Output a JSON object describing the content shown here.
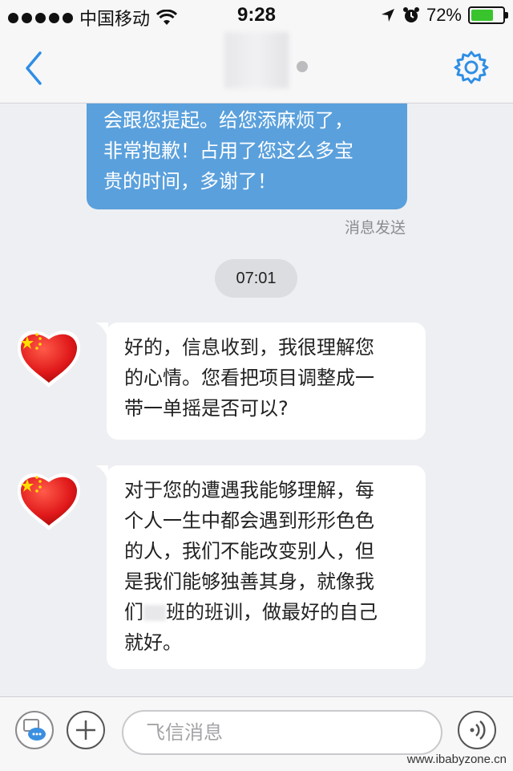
{
  "status_bar": {
    "carrier": "中国移动",
    "time": "9:28",
    "battery_percent": "72%",
    "battery_level": 0.72,
    "signal_icon": "signal-dots-icon",
    "wifi_icon": "wifi-icon",
    "location_icon": "location-arrow-icon",
    "alarm_icon": "alarm-icon"
  },
  "nav": {
    "back_icon": "back-chevron-icon",
    "settings_icon": "gear-icon",
    "accent": "#2f8ee5"
  },
  "messages": {
    "outgoing_lines": [
      "会跟您提起。给您添麻烦了，",
      "非常抱歉！占用了您这么多宝",
      "贵的时间，多谢了！"
    ],
    "outgoing_status": "消息发送",
    "timestamp": "07:01",
    "incoming_1_lines": [
      "好的，信息收到，我很理解您",
      "的心情。您看把项目调整成一",
      "带一单摇是否可以?"
    ],
    "incoming_2_lines": [
      "对于您的遭遇我能够理解，每",
      "个人一生中都会遇到形形色色",
      "的人，我们不能改变别人，但",
      "是我们能够独善其身，就像我",
      "们",
      "班的班训，做最好的自己",
      "就好。"
    ]
  },
  "input_bar": {
    "placeholder": "飞信消息",
    "message_icon": "sms-switch-icon",
    "add_icon": "plus-icon",
    "voice_icon": "voice-icon"
  },
  "watermark": "www.ibabyzone.cn"
}
